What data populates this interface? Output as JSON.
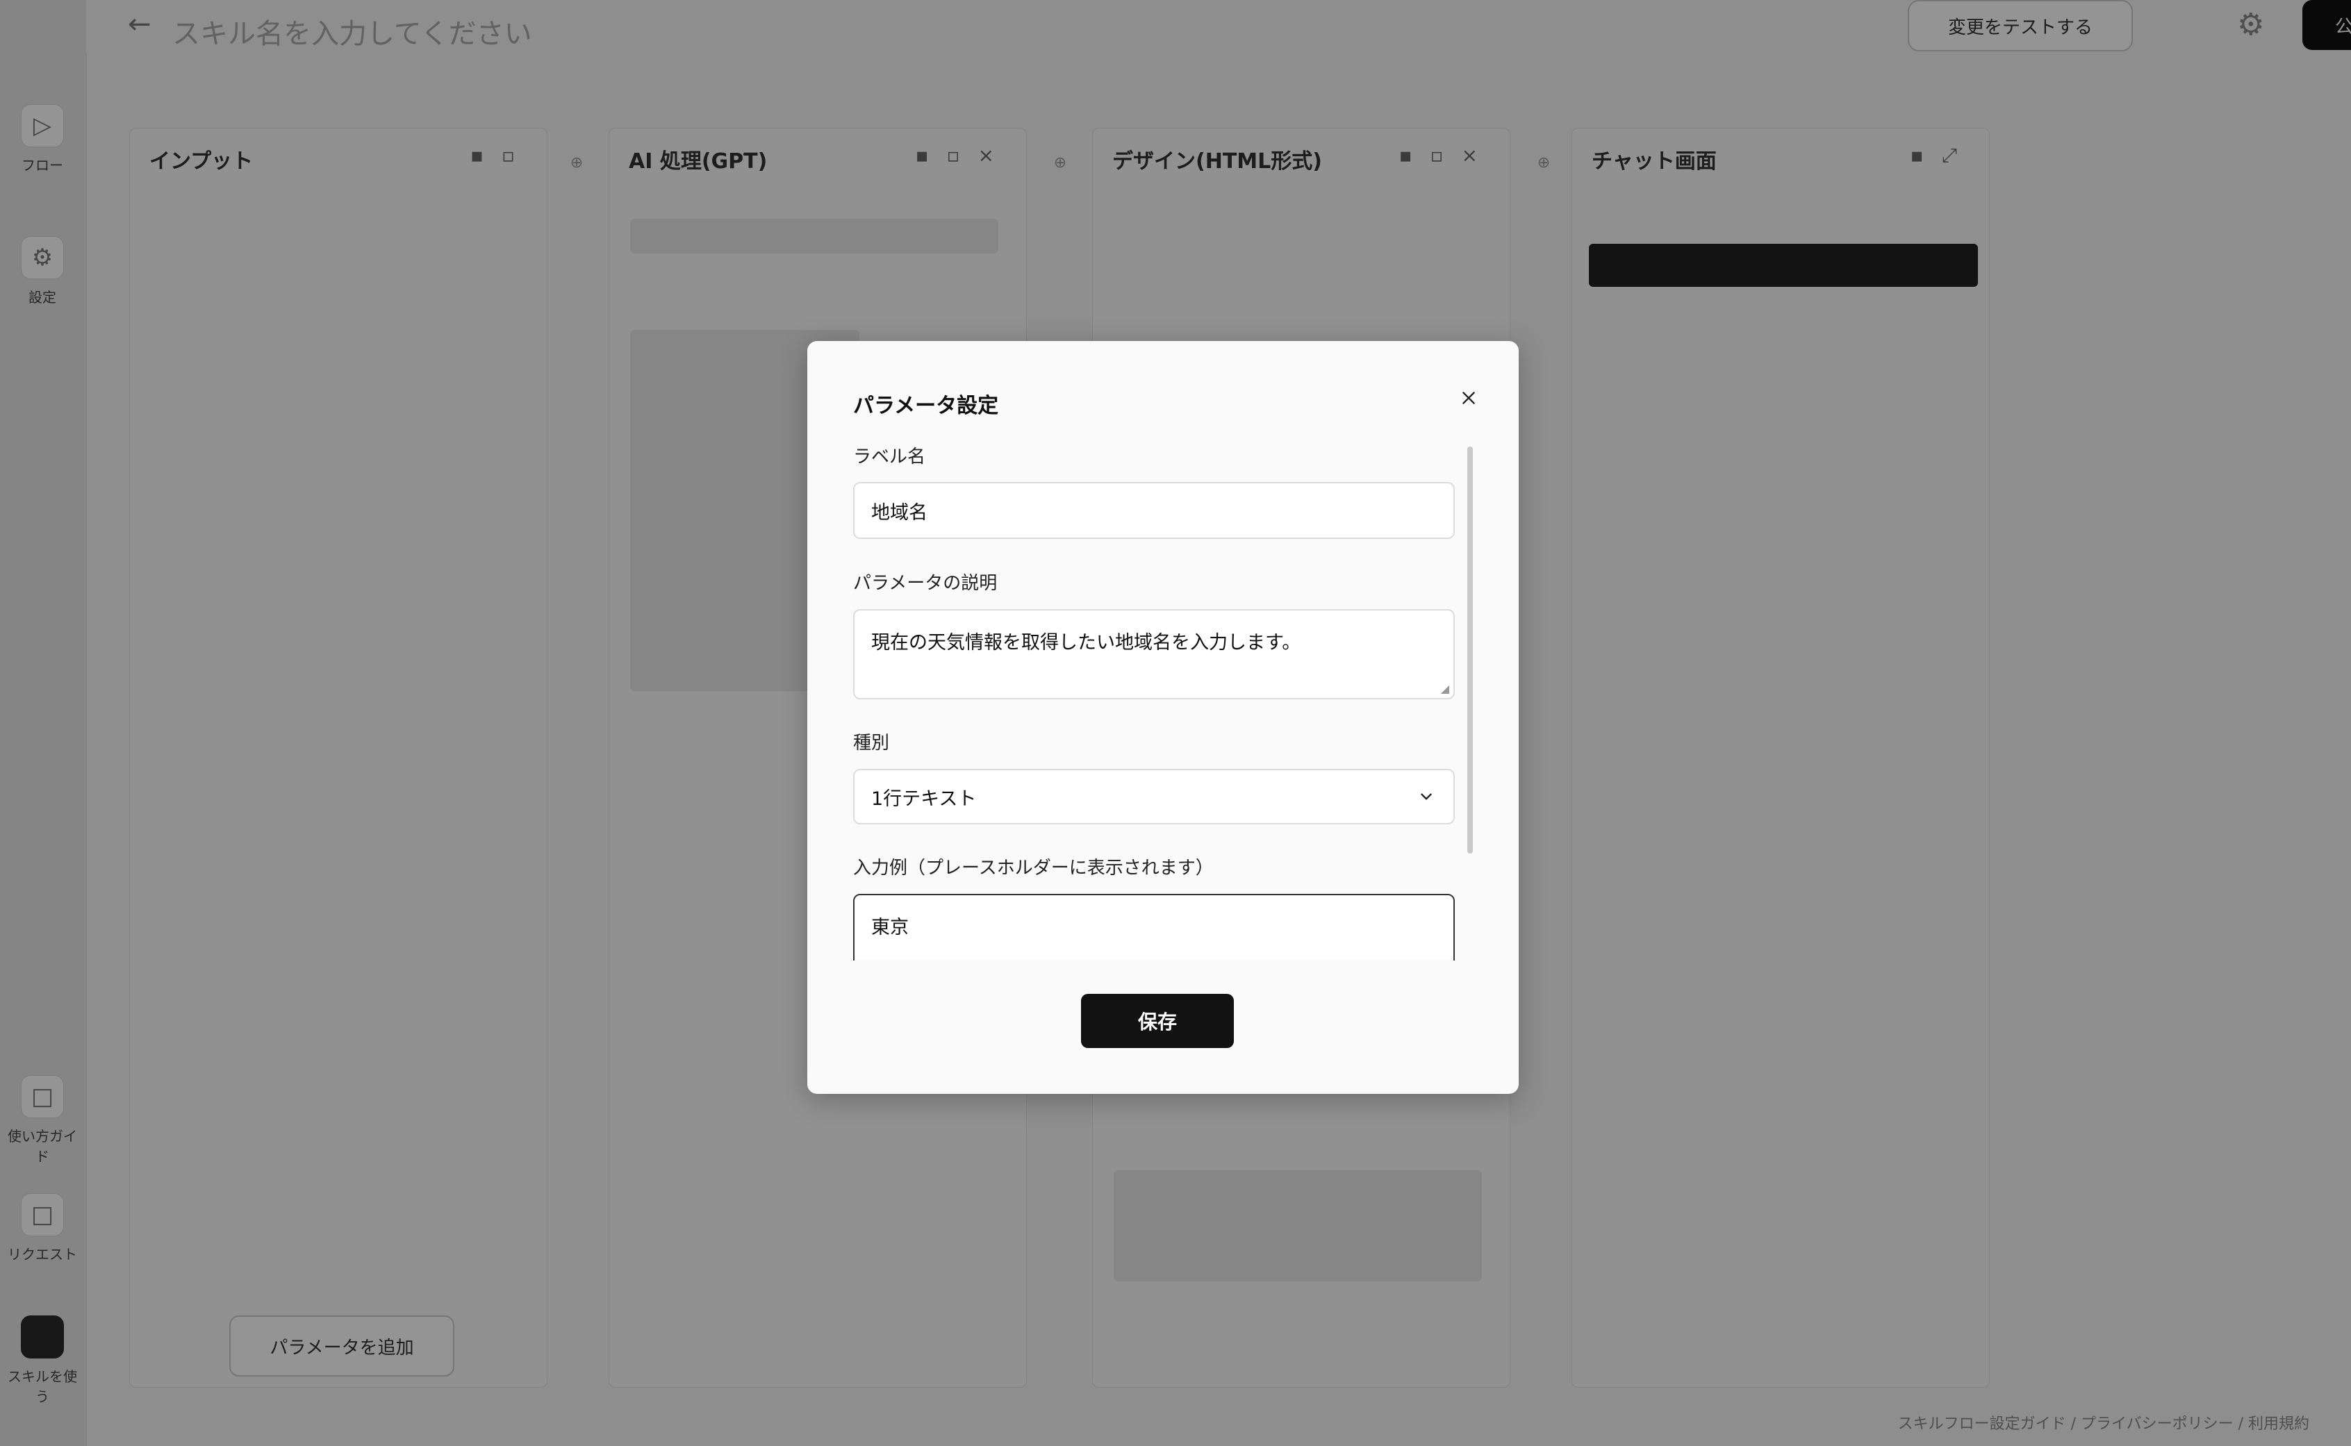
{
  "sidebar": {
    "items": [
      {
        "label": "フロー"
      },
      {
        "label": "設定"
      },
      {
        "label": "使い方ガイド"
      },
      {
        "label": "リクエスト"
      },
      {
        "label": "スキルを使う"
      }
    ]
  },
  "header": {
    "title_placeholder": "スキル名を入力してください",
    "publish_label": "公開",
    "outline_button_label": "変更をテストする"
  },
  "columns": [
    {
      "title": "インプット"
    },
    {
      "title": "AI 処理(GPT)"
    },
    {
      "title": "デザイン(HTML形式)"
    },
    {
      "title": "チャット画面"
    }
  ],
  "background": {
    "add_param_label": "パラメータを追加",
    "footer_text": "スキルフロー設定ガイド / プライバシーポリシー / 利用規約"
  },
  "modal": {
    "title": "パラメータ設定",
    "fields": {
      "label_name": {
        "label": "ラベル名",
        "value": "地域名"
      },
      "description": {
        "label": "パラメータの説明",
        "value": "現在の天気情報を取得したい地域名を入力します。"
      },
      "type": {
        "label": "種別",
        "value": "1行テキスト"
      },
      "example": {
        "label": "入力例（プレースホルダーに表示されます）",
        "value": "東京"
      }
    },
    "save_label": "保存"
  }
}
